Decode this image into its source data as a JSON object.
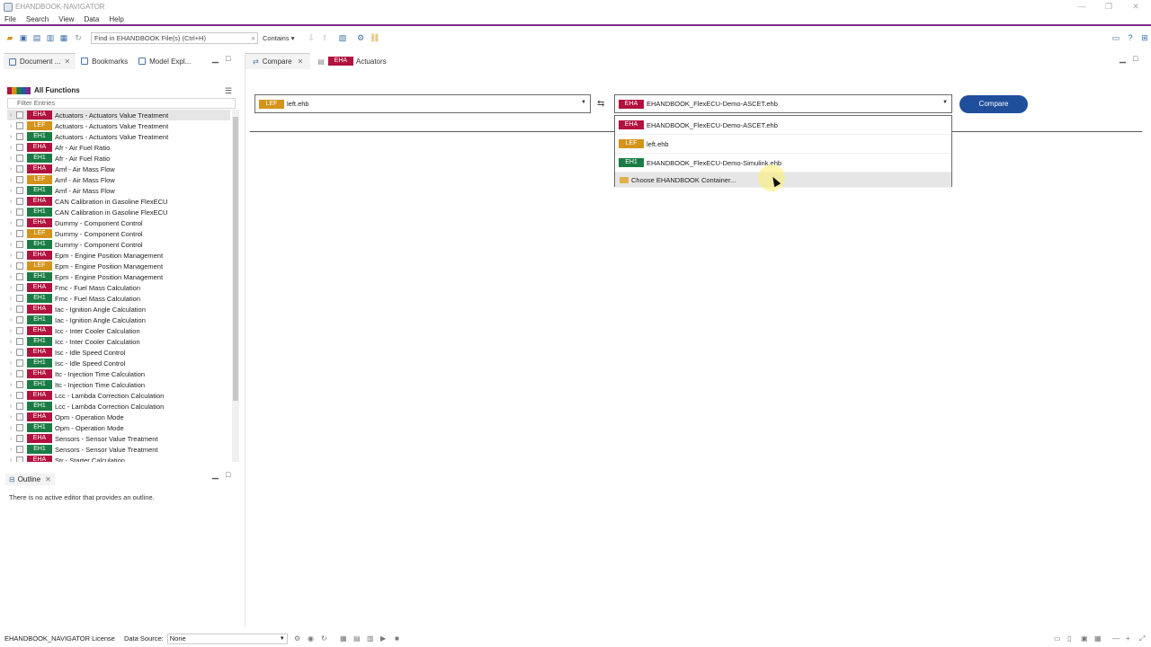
{
  "app": {
    "title": "EHANDBOOK-NAVIGATOR"
  },
  "window_controls": {
    "minimize": "—",
    "restore": "❐",
    "close": "✕"
  },
  "menu": [
    "File",
    "Search",
    "View",
    "Data",
    "Help"
  ],
  "toolbar": {
    "search_placeholder": "Find in EHANDBOOK File(s) (Ctrl+H)",
    "search_mode": "Contains"
  },
  "left_panel": {
    "tabs": [
      {
        "label": "Document ..."
      },
      {
        "label": "Bookmarks"
      },
      {
        "label": "Model Expl..."
      }
    ],
    "tree_title": "All Functions",
    "filter_placeholder": "Filter Entries",
    "rows": [
      {
        "tag": "EHA",
        "label": "Actuators - Actuators Value Treatment"
      },
      {
        "tag": "LEF",
        "label": "Actuators - Actuators Value Treatment"
      },
      {
        "tag": "EH1",
        "label": "Actuators - Actuators Value Treatment"
      },
      {
        "tag": "EHA",
        "label": "Afr - Air Fuel Ratio"
      },
      {
        "tag": "EH1",
        "label": "Afr - Air Fuel Ratio"
      },
      {
        "tag": "EHA",
        "label": "Amf - Air Mass Flow"
      },
      {
        "tag": "LEF",
        "label": "Amf - Air Mass Flow"
      },
      {
        "tag": "EH1",
        "label": "Amf - Air Mass Flow"
      },
      {
        "tag": "EHA",
        "label": "CAN Calibration in Gasoline FlexECU"
      },
      {
        "tag": "EH1",
        "label": "CAN Calibration in Gasoline FlexECU"
      },
      {
        "tag": "EHA",
        "label": "Dummy - Component Control"
      },
      {
        "tag": "LEF",
        "label": "Dummy - Component Control"
      },
      {
        "tag": "EH1",
        "label": "Dummy - Component Control"
      },
      {
        "tag": "EHA",
        "label": "Epm - Engine Position Management"
      },
      {
        "tag": "LEF",
        "label": "Epm - Engine Position Management"
      },
      {
        "tag": "EH1",
        "label": "Epm - Engine Position Management"
      },
      {
        "tag": "EHA",
        "label": "Fmc - Fuel Mass Calculation"
      },
      {
        "tag": "EH1",
        "label": "Fmc - Fuel Mass Calculation"
      },
      {
        "tag": "EHA",
        "label": "Iac - Ignition Angle Calculation"
      },
      {
        "tag": "EH1",
        "label": "Iac - Ignition Angle Calculation"
      },
      {
        "tag": "EHA",
        "label": "Icc - Inter Cooler Calculation"
      },
      {
        "tag": "EH1",
        "label": "Icc - Inter Cooler Calculation"
      },
      {
        "tag": "EHA",
        "label": "Isc - Idle Speed Control"
      },
      {
        "tag": "EH1",
        "label": "Isc - Idle Speed Control"
      },
      {
        "tag": "EHA",
        "label": "Itc - Injection Time Calculation"
      },
      {
        "tag": "EH1",
        "label": "Itc - Injection Time Calculation"
      },
      {
        "tag": "EHA",
        "label": "Lcc - Lambda Correction Calculation"
      },
      {
        "tag": "EH1",
        "label": "Lcc - Lambda Correction Calculation"
      },
      {
        "tag": "EHA",
        "label": "Opm - Operation Mode"
      },
      {
        "tag": "EH1",
        "label": "Opm - Operation Mode"
      },
      {
        "tag": "EHA",
        "label": "Sensors - Sensor Value Treatment"
      },
      {
        "tag": "EH1",
        "label": "Sensors - Sensor Value Treatment"
      },
      {
        "tag": "EHA",
        "label": "Str - Starter Calculation"
      }
    ]
  },
  "outline": {
    "tab_label": "Outline",
    "message": "There is no active editor that provides an outline."
  },
  "editor": {
    "tabs": [
      {
        "label": "Compare"
      },
      {
        "tag": "EHA",
        "label": "Actuators"
      }
    ],
    "left_combo": {
      "tag": "LEF",
      "value": "left.ehb"
    },
    "right_combo": {
      "tag": "EHA",
      "value": "EHANDBOOK_FlexECU-Demo-ASCET.ehb"
    },
    "compare_label": "Compare",
    "dropdown": [
      {
        "tag": "EHA",
        "label": "EHANDBOOK_FlexECU-Demo-ASCET.ehb"
      },
      {
        "tag": "LEF",
        "label": "left.ehb"
      },
      {
        "tag": "EH1",
        "label": "EHANDBOOK_FlexECU-Demo-Simulink.ehb"
      }
    ],
    "choose_label": "Choose EHANDBOOK Container..."
  },
  "statusbar": {
    "license": "EHANDBOOK_NAVIGATOR License",
    "datasource_label": "Data Source:",
    "datasource_value": "None"
  },
  "colors": {
    "EHA": "#b2123e",
    "LEF": "#d4931a",
    "EH1": "#1a7c44",
    "accent": "#7f2a8c",
    "compare_button": "#1f4e9a"
  }
}
